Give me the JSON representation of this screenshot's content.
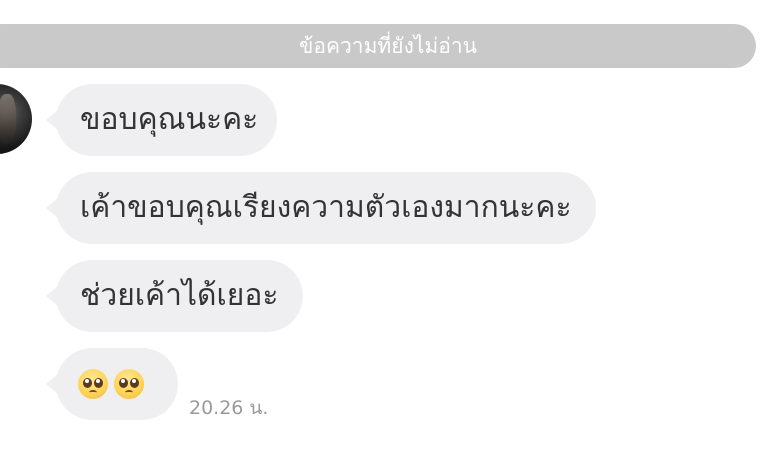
{
  "banner": {
    "text": "ข้อความที่ยังไม่อ่าน"
  },
  "messages": [
    {
      "text": "ขอบคุณนะคะ"
    },
    {
      "text": "เค้าขอบคุณเรียงความตัวเองมากนะคะ"
    },
    {
      "text": "ช่วยเค้าได้เยอะ"
    },
    {
      "emoji": [
        "pleading-face-icon",
        "pleading-face-icon"
      ]
    }
  ],
  "timestamp": "20.26 น.",
  "colors": {
    "banner_bg": "#c9c9c9",
    "bubble_bg": "#efeff1",
    "text": "#333333",
    "timestamp": "#9a9a9a"
  }
}
